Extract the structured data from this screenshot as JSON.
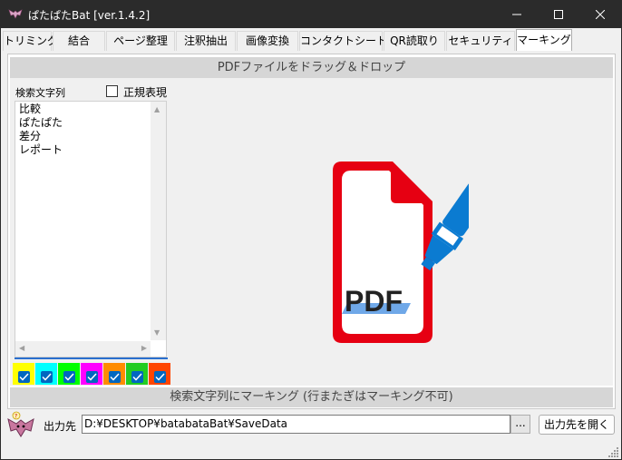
{
  "window": {
    "title": "ぱたぱたBat [ver.1.4.2]",
    "icons": {
      "app": "bat-icon",
      "minimize": "minimize-icon",
      "maximize": "maximize-icon",
      "close": "close-icon"
    }
  },
  "tabs": [
    {
      "label": "トリミング"
    },
    {
      "label": "結合"
    },
    {
      "label": "ページ整理"
    },
    {
      "label": "注釈抽出"
    },
    {
      "label": "画像変換"
    },
    {
      "label": "コンタクトシート"
    },
    {
      "label": "QR読取り"
    },
    {
      "label": "セキュリティ"
    },
    {
      "label": "マーキング",
      "active": true
    }
  ],
  "drop_zone": {
    "header": "PDFファイルをドラッグ＆ドロップ",
    "icon": "pdf-highlighter-icon",
    "icon_text": "PDF",
    "colors": {
      "document": "#e60012",
      "highlighter": "#0b7bd1",
      "highlight": "#6fa8e8"
    }
  },
  "search": {
    "label": "検索文字列",
    "regex_label": "正規表現",
    "regex_checked": false,
    "terms": [
      "比較",
      "ぱたぱた",
      "差分",
      "レポート"
    ]
  },
  "color_swatches": [
    {
      "color": "#ffff00",
      "checked": true
    },
    {
      "color": "#00ffff",
      "checked": true
    },
    {
      "color": "#00ff00",
      "checked": true
    },
    {
      "color": "#ff00ff",
      "checked": true
    },
    {
      "color": "#ff8c00",
      "checked": true
    },
    {
      "color": "#22cc22",
      "checked": true
    },
    {
      "color": "#ff4500",
      "checked": true
    }
  ],
  "marking_button": "検索文字列にマーキング (行またぎはマーキング不可)",
  "output": {
    "label": "出力先",
    "path": "D:¥DESKTOP¥batabataBat¥SaveData",
    "browse_label": "...",
    "open_label": "出力先を開く"
  }
}
